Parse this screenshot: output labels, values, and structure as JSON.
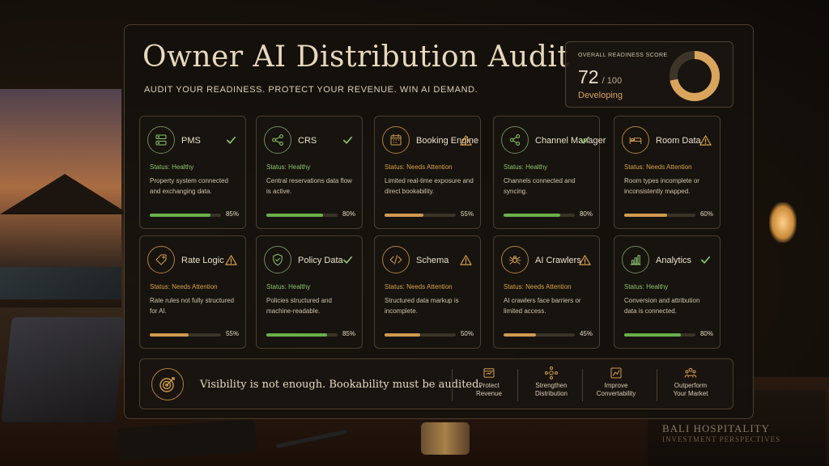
{
  "header": {
    "title": "Owner AI Distribution Audit",
    "subtitle": "AUDIT YOUR READINESS. PROTECT YOUR REVENUE. WIN AI DEMAND."
  },
  "score": {
    "label": "OVERALL READINESS SCORE",
    "value": "72",
    "max": "/ 100",
    "status": "Developing",
    "fraction": 0.72,
    "ring_color": "#d9a45c"
  },
  "cards": [
    {
      "name": "PMS",
      "icon": "server-icon",
      "state": "ok",
      "status": "Status: Healthy",
      "desc": "Property system connected and exchanging data.",
      "pct_label": "85%",
      "progress": 0.85
    },
    {
      "name": "CRS",
      "icon": "network-nodes-icon",
      "state": "ok",
      "status": "Status: Healthy",
      "desc": "Central reservations data flow is active.",
      "pct_label": "80%",
      "progress": 0.8
    },
    {
      "name": "Booking Engine",
      "icon": "calendar-icon",
      "state": "warn",
      "status": "Status: Needs Attention",
      "desc": "Limited real-time exposure and direct bookability.",
      "pct_label": "55%",
      "progress": 0.55
    },
    {
      "name": "Channel Manager",
      "icon": "share-nodes-icon",
      "state": "ok",
      "status": "Status: Healthy",
      "desc": "Channels connected and syncing.",
      "pct_label": "80%",
      "progress": 0.8
    },
    {
      "name": "Room Data",
      "icon": "bed-icon",
      "state": "warn",
      "status": "Status: Needs Attention",
      "desc": "Room types incomplete or inconsistently mapped.",
      "pct_label": "60%",
      "progress": 0.6
    },
    {
      "name": "Rate Logic",
      "icon": "price-tag-icon",
      "state": "warn",
      "status": "Status: Needs Attention",
      "desc": "Rate rules not fully structured for AI.",
      "pct_label": "55%",
      "progress": 0.55
    },
    {
      "name": "Policy Data",
      "icon": "shield-check-icon",
      "state": "ok",
      "status": "Status: Healthy",
      "desc": "Policies structured and machine-readable.",
      "pct_label": "85%",
      "progress": 0.85
    },
    {
      "name": "Schema",
      "icon": "code-icon",
      "state": "warn",
      "status": "Status: Needs Attention",
      "desc": "Structured data markup is incomplete.",
      "pct_label": "50%",
      "progress": 0.5
    },
    {
      "name": "AI Crawlers",
      "icon": "spider-icon",
      "state": "warn",
      "status": "Status: Needs Attention",
      "desc": "AI crawlers face barriers or limited access.",
      "pct_label": "45%",
      "progress": 0.45
    },
    {
      "name": "Analytics",
      "icon": "bar-chart-icon",
      "state": "ok",
      "status": "Status: Healthy",
      "desc": "Conversion and attribution data is connected.",
      "pct_label": "80%",
      "progress": 0.8
    }
  ],
  "footer": {
    "icon": "target-icon",
    "message": "Visibility is not enough. Bookability must be audited.",
    "actions": [
      {
        "icon": "revenue-icon",
        "line1": "Protect",
        "line2": "Revenue"
      },
      {
        "icon": "distribution-icon",
        "line1": "Strengthen",
        "line2": "Distribution"
      },
      {
        "icon": "convert-chart-icon",
        "line1": "Improve",
        "line2": "Convertability"
      },
      {
        "icon": "market-people-icon",
        "line1": "Outperform",
        "line2": "Your Market"
      }
    ]
  },
  "background": {
    "book_title": "BALI HOSPITALITY",
    "book_subtitle": "INVESTMENT PERSPECTIVES"
  },
  "colors": {
    "healthy": "#6ab04c",
    "attention": "#d09a50",
    "accent": "#d9a45c"
  }
}
